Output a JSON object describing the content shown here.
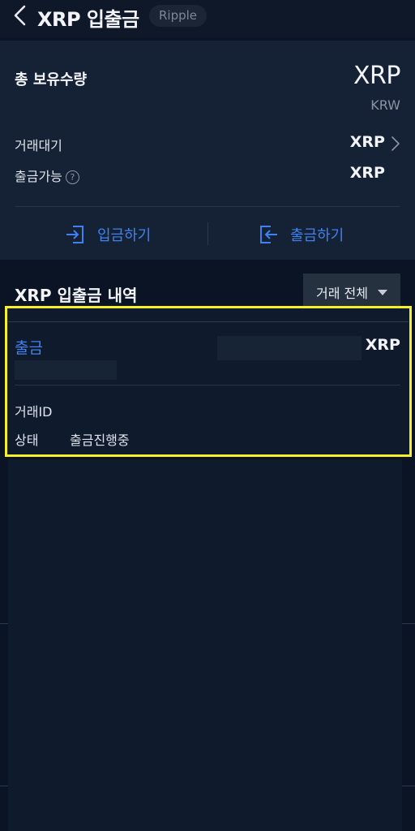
{
  "header": {
    "title": "XRP 입출금",
    "coin_badge": "Ripple"
  },
  "summary": {
    "holdings_label": "총 보유수량",
    "holdings_xrp": "XRP",
    "holdings_krw": "KRW",
    "pending_label": "거래대기",
    "pending_value": "XRP",
    "available_label": "출금가능",
    "available_value": "XRP",
    "help_glyph": "?",
    "deposit_label": "입금하기",
    "withdraw_label": "출금하기"
  },
  "history": {
    "title": "XRP 입출금 내역",
    "filter_label": "거래 전체"
  },
  "transaction": {
    "type": "출금",
    "unit": "XRP",
    "id_label": "거래ID",
    "status_label": "상태",
    "status_value": "출금진행중"
  },
  "colors": {
    "background": "#0b1424",
    "panel": "#152235",
    "accent_blue": "#3f82ef",
    "highlight_yellow": "#f5f02a"
  },
  "icons": {
    "back": "chevron-left-icon",
    "pending_arrow": "chevron-right-icon",
    "help": "question-circle-icon",
    "deposit": "login-arrow-icon",
    "withdraw": "logout-arrow-icon",
    "filter": "caret-down-icon"
  }
}
